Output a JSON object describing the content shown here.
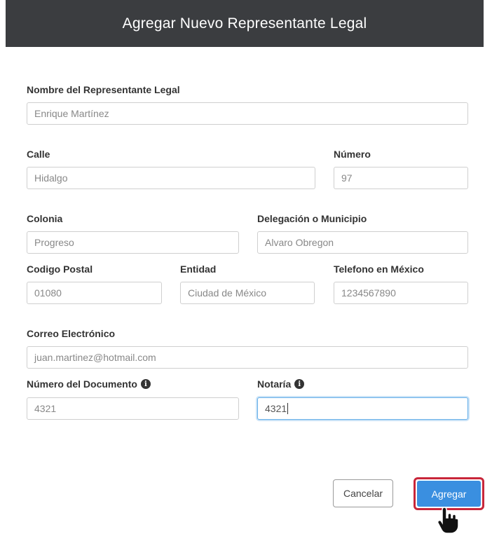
{
  "modal": {
    "title": "Agregar Nuevo Representante Legal"
  },
  "fields": {
    "nombre": {
      "label": "Nombre del Representante Legal",
      "value": "Enrique Martínez"
    },
    "calle": {
      "label": "Calle",
      "value": "Hidalgo"
    },
    "numero": {
      "label": "Número",
      "value": "97"
    },
    "colonia": {
      "label": "Colonia",
      "value": "Progreso"
    },
    "delegacion": {
      "label": "Delegación o Municipio",
      "value": "Alvaro Obregon"
    },
    "codigo_postal": {
      "label": "Codigo Postal",
      "value": "01080"
    },
    "entidad": {
      "label": "Entidad",
      "value": "Ciudad de México"
    },
    "telefono": {
      "label": "Telefono en México",
      "value": "1234567890"
    },
    "correo": {
      "label": "Correo Electrónico",
      "value": "juan.martinez@hotmail.com"
    },
    "num_documento": {
      "label": "Número del Documento",
      "value": "4321"
    },
    "notaria": {
      "label": "Notaría",
      "value": "4321"
    }
  },
  "buttons": {
    "cancel": "Cancelar",
    "add": "Agregar"
  },
  "icons": {
    "info": "info-circle-icon",
    "cursor": "hand-pointer-icon"
  },
  "colors": {
    "header_bg": "#3b3d40",
    "accent": "#3a8fe0",
    "highlight": "#c8263a"
  }
}
